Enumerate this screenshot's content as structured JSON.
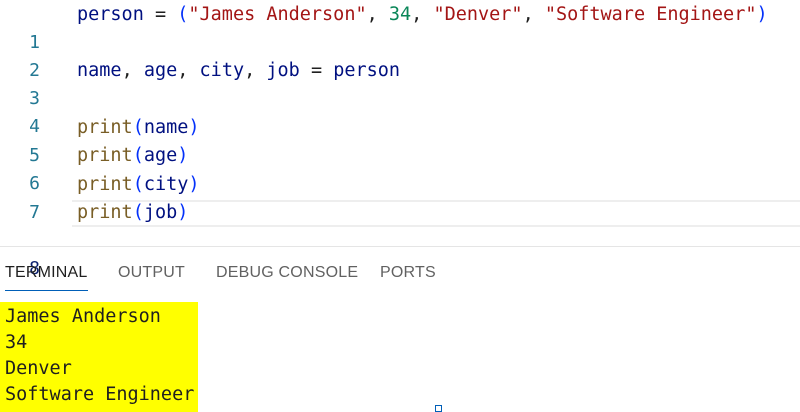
{
  "editor": {
    "lines": [
      {
        "number": "1",
        "tokens": {
          "t1": "person",
          "t2": " = ",
          "t3": "(",
          "t4": "\"James Anderson\"",
          "t5": ", ",
          "t6": "34",
          "t7": ", ",
          "t8": "\"Denver\"",
          "t9": ", ",
          "t10": "\"Software Engineer\"",
          "t11": ")"
        }
      },
      {
        "number": "2"
      },
      {
        "number": "3",
        "tokens": {
          "t1": "name",
          "t2": ", ",
          "t3": "age",
          "t4": ", ",
          "t5": "city",
          "t6": ", ",
          "t7": "job",
          "t8": " = ",
          "t9": "person"
        }
      },
      {
        "number": "4"
      },
      {
        "number": "5",
        "tokens": {
          "fn": "print",
          "open": "(",
          "arg": "name",
          "close": ")"
        }
      },
      {
        "number": "6",
        "tokens": {
          "fn": "print",
          "open": "(",
          "arg": "age",
          "close": ")"
        }
      },
      {
        "number": "7",
        "tokens": {
          "fn": "print",
          "open": "(",
          "arg": "city",
          "close": ")"
        }
      },
      {
        "number": "8",
        "tokens": {
          "fn": "print",
          "open": "(",
          "arg": "job",
          "close": ")"
        }
      }
    ],
    "current_line": "8"
  },
  "panel": {
    "tabs": [
      {
        "label": "TERMINAL",
        "active": true
      },
      {
        "label": "OUTPUT",
        "active": false
      },
      {
        "label": "DEBUG CONSOLE",
        "active": false
      },
      {
        "label": "PORTS",
        "active": false
      }
    ]
  },
  "terminal": {
    "output": [
      "James Anderson",
      "34",
      "Denver",
      "Software Engineer"
    ],
    "highlight_color": "#ffff00"
  },
  "colors": {
    "string": "#a31515",
    "number": "#098658",
    "variable": "#001080",
    "function": "#795e26",
    "bracket_outer": "#0431fa",
    "bracket_inner": "#319331",
    "line_number": "#237893",
    "active_tab_underline": "#005fb8"
  }
}
